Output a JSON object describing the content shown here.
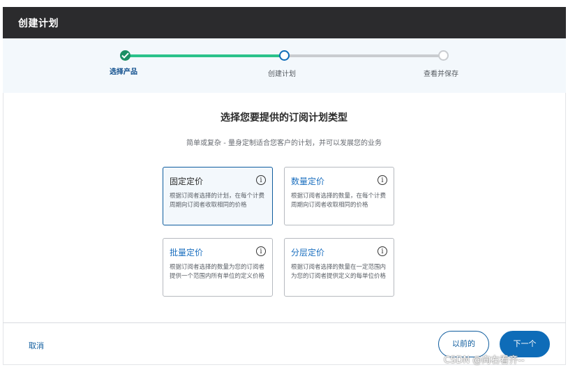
{
  "window": {
    "title": "创建计划"
  },
  "stepper": {
    "steps": [
      {
        "label": "选择产品",
        "state": "completed"
      },
      {
        "label": "创建计划",
        "state": "current"
      },
      {
        "label": "查看并保存",
        "state": "pending"
      }
    ],
    "colors": {
      "completed": "#2bc28b",
      "current": "#0e6cb8",
      "pending": "#c9ccd0"
    }
  },
  "main": {
    "heading": "选择您要提供的订阅计划类型",
    "subheading": "简单或复杂 - 量身定制适合您客户的计划，并可以发展您的业务",
    "options": [
      {
        "title": "固定定价",
        "desc": "根据订阅者选择的计划，在每个计费周期向订阅者收取相同的价格",
        "selected": true
      },
      {
        "title": "数量定价",
        "desc": "根据订阅者选择的数量，在每个计费周期向订阅者收取相同的价格",
        "selected": false
      },
      {
        "title": "批量定价",
        "desc": "根据订阅者选择的数量为您的订阅者提供一个范围内所有单位的定义价格",
        "selected": false
      },
      {
        "title": "分层定价",
        "desc": "根据订阅者选择的数量在一定范围内为您的订阅者提供定义的每单位价格",
        "selected": false
      }
    ],
    "info_icon": "info-icon",
    "info_glyph": "i"
  },
  "footer": {
    "cancel_label": "取消",
    "prev_label": "以前的",
    "next_label": "下一个"
  },
  "watermark": "CSDN @向右看齐--",
  "colors": {
    "accent": "#0e6cb8",
    "titlebar": "#2b2b2d",
    "success": "#1c8f64"
  }
}
